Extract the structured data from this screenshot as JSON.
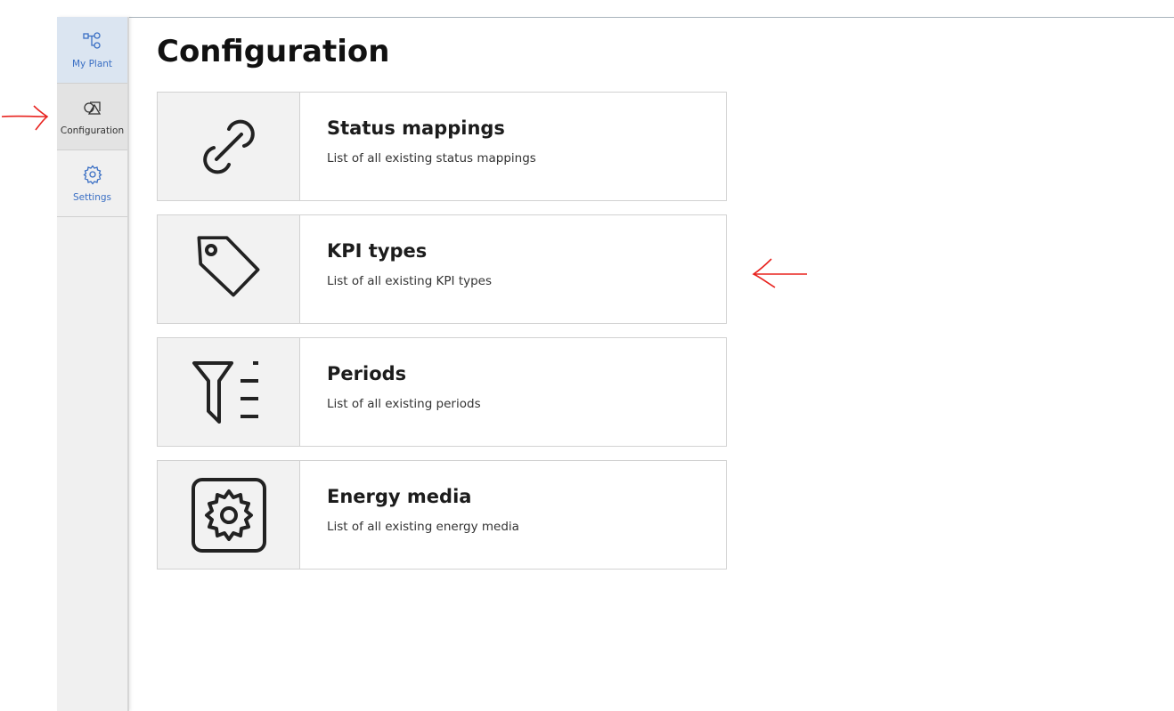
{
  "sidebar": {
    "items": [
      {
        "label": "My Plant",
        "icon": "hierarchy-icon"
      },
      {
        "label": "Configuration",
        "icon": "shapes-icon",
        "active": true
      },
      {
        "label": "Settings",
        "icon": "gear-icon"
      }
    ]
  },
  "page": {
    "title": "Configuration"
  },
  "cards": [
    {
      "title": "Status mappings",
      "description": "List of all existing status mappings",
      "icon": "link-icon"
    },
    {
      "title": "KPI types",
      "description": "List of all existing KPI types",
      "icon": "tag-icon"
    },
    {
      "title": "Periods",
      "description": "List of all existing periods",
      "icon": "filter-list-icon"
    },
    {
      "title": "Energy media",
      "description": "List of all existing energy media",
      "icon": "gear-box-icon"
    }
  ],
  "colors": {
    "accent": "#3a6fc4",
    "annotation": "#e8231f"
  }
}
